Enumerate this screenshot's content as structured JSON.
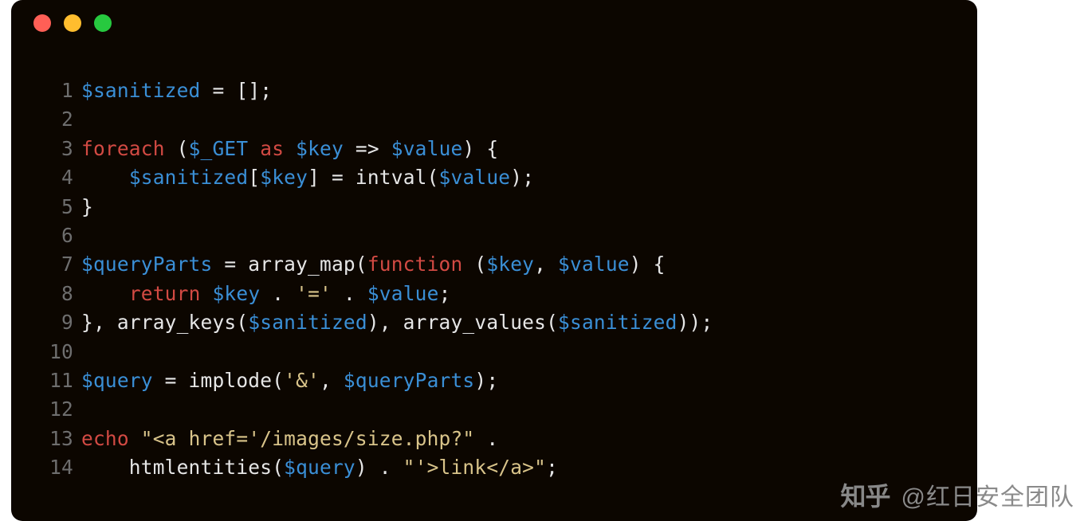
{
  "traffic_lights": [
    "close",
    "minimize",
    "zoom"
  ],
  "code": {
    "lines": [
      {
        "n": "1",
        "tokens": [
          {
            "c": "tok-var",
            "t": "$sanitized"
          },
          {
            "c": "tok-punc",
            "t": " = [];"
          }
        ]
      },
      {
        "n": "2",
        "tokens": []
      },
      {
        "n": "3",
        "tokens": [
          {
            "c": "tok-kw",
            "t": "foreach"
          },
          {
            "c": "tok-punc",
            "t": " ("
          },
          {
            "c": "tok-var",
            "t": "$_GET"
          },
          {
            "c": "tok-punc",
            "t": " "
          },
          {
            "c": "tok-kw",
            "t": "as"
          },
          {
            "c": "tok-punc",
            "t": " "
          },
          {
            "c": "tok-var",
            "t": "$key"
          },
          {
            "c": "tok-punc",
            "t": " => "
          },
          {
            "c": "tok-var",
            "t": "$value"
          },
          {
            "c": "tok-punc",
            "t": ") {"
          }
        ]
      },
      {
        "n": "4",
        "tokens": [
          {
            "c": "tok-plain",
            "t": "    "
          },
          {
            "c": "tok-var",
            "t": "$sanitized"
          },
          {
            "c": "tok-punc",
            "t": "["
          },
          {
            "c": "tok-var",
            "t": "$key"
          },
          {
            "c": "tok-punc",
            "t": "] = intval("
          },
          {
            "c": "tok-var",
            "t": "$value"
          },
          {
            "c": "tok-punc",
            "t": ");"
          }
        ]
      },
      {
        "n": "5",
        "tokens": [
          {
            "c": "tok-punc",
            "t": "}"
          }
        ]
      },
      {
        "n": "6",
        "tokens": []
      },
      {
        "n": "7",
        "tokens": [
          {
            "c": "tok-var",
            "t": "$queryParts"
          },
          {
            "c": "tok-punc",
            "t": " = array_map("
          },
          {
            "c": "tok-kw",
            "t": "function"
          },
          {
            "c": "tok-punc",
            "t": " ("
          },
          {
            "c": "tok-var",
            "t": "$key"
          },
          {
            "c": "tok-punc",
            "t": ", "
          },
          {
            "c": "tok-var",
            "t": "$value"
          },
          {
            "c": "tok-punc",
            "t": ") {"
          }
        ]
      },
      {
        "n": "8",
        "tokens": [
          {
            "c": "tok-plain",
            "t": "    "
          },
          {
            "c": "tok-kw",
            "t": "return"
          },
          {
            "c": "tok-punc",
            "t": " "
          },
          {
            "c": "tok-var",
            "t": "$key"
          },
          {
            "c": "tok-punc",
            "t": " . "
          },
          {
            "c": "tok-str",
            "t": "'='"
          },
          {
            "c": "tok-punc",
            "t": " . "
          },
          {
            "c": "tok-var",
            "t": "$value"
          },
          {
            "c": "tok-punc",
            "t": ";"
          }
        ]
      },
      {
        "n": "9",
        "tokens": [
          {
            "c": "tok-punc",
            "t": "}, array_keys("
          },
          {
            "c": "tok-var",
            "t": "$sanitized"
          },
          {
            "c": "tok-punc",
            "t": "), array_values("
          },
          {
            "c": "tok-var",
            "t": "$sanitized"
          },
          {
            "c": "tok-punc",
            "t": "));"
          }
        ]
      },
      {
        "n": "10",
        "tokens": []
      },
      {
        "n": "11",
        "tokens": [
          {
            "c": "tok-var",
            "t": "$query"
          },
          {
            "c": "tok-punc",
            "t": " = implode("
          },
          {
            "c": "tok-str",
            "t": "'&'"
          },
          {
            "c": "tok-punc",
            "t": ", "
          },
          {
            "c": "tok-var",
            "t": "$queryParts"
          },
          {
            "c": "tok-punc",
            "t": ");"
          }
        ]
      },
      {
        "n": "12",
        "tokens": []
      },
      {
        "n": "13",
        "tokens": [
          {
            "c": "tok-kw",
            "t": "echo"
          },
          {
            "c": "tok-punc",
            "t": " "
          },
          {
            "c": "tok-str",
            "t": "\"<a href='/images/size.php?\""
          },
          {
            "c": "tok-punc",
            "t": " ."
          }
        ]
      },
      {
        "n": "14",
        "tokens": [
          {
            "c": "tok-plain",
            "t": "    htmlentities("
          },
          {
            "c": "tok-var",
            "t": "$query"
          },
          {
            "c": "tok-punc",
            "t": ") . "
          },
          {
            "c": "tok-str",
            "t": "\"'>link</a>\""
          },
          {
            "c": "tok-punc",
            "t": ";"
          }
        ]
      }
    ]
  },
  "watermark": {
    "logo_text": "知乎",
    "attribution": "@红日安全团队"
  }
}
